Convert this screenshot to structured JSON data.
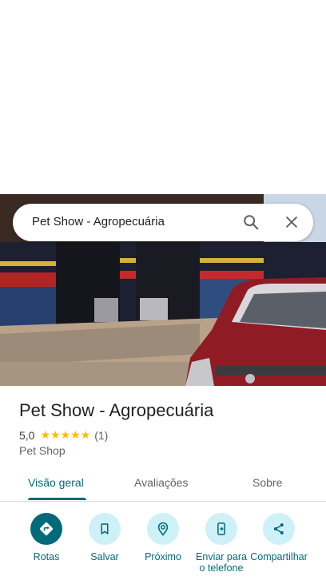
{
  "search": {
    "query": "Pet Show - Agropecuária",
    "search_icon": "search-icon",
    "close_icon": "close-icon"
  },
  "photo": {
    "description_icon": "storefront-photo"
  },
  "place": {
    "title": "Pet Show - Agropecuária",
    "rating": "5,0",
    "stars": "★★★★★",
    "review_count": "(1)",
    "category": "Pet Shop"
  },
  "tabs": [
    {
      "label": "Visão geral",
      "active": true
    },
    {
      "label": "Avaliações",
      "active": false
    },
    {
      "label": "Sobre",
      "active": false
    }
  ],
  "actions": [
    {
      "label": "Rotas",
      "icon": "directions-icon"
    },
    {
      "label": "Salvar",
      "icon": "bookmark-icon"
    },
    {
      "label": "Próximo",
      "icon": "nearby-icon"
    },
    {
      "label": "Enviar para o telefone",
      "icon": "send-to-phone-icon"
    },
    {
      "label": "Compartilhar",
      "icon": "share-icon"
    }
  ],
  "colors": {
    "accent": "#00697a",
    "accent_light": "#cdf1f7",
    "star": "#fbbc04"
  }
}
